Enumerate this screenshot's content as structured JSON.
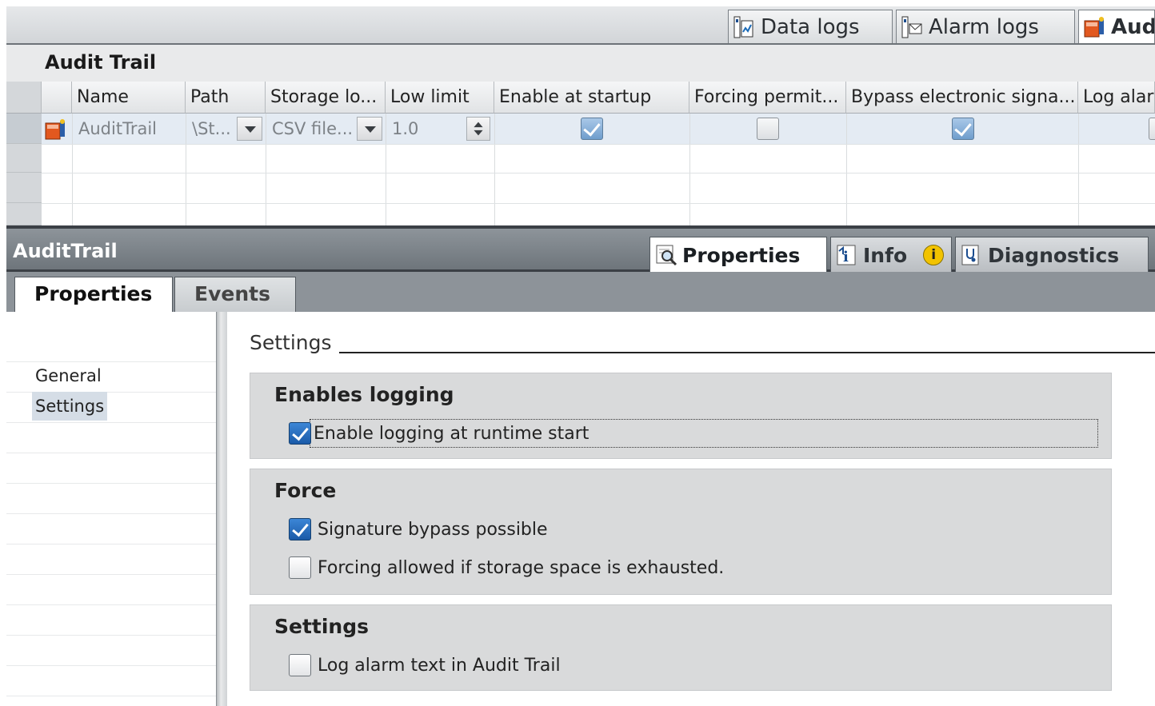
{
  "top_tabs": [
    {
      "label": "Data logs",
      "icon": "data-log-icon",
      "active": false
    },
    {
      "label": "Alarm logs",
      "icon": "alarm-log-icon",
      "active": false
    },
    {
      "label": "Aud",
      "icon": "audit-trail-icon",
      "active": true
    }
  ],
  "editor": {
    "title": "Audit Trail",
    "columns": [
      "Name",
      "Path",
      "Storage lo...",
      "Low limit",
      "Enable at startup",
      "Forcing permit...",
      "Bypass electronic signa...",
      "Log alar"
    ],
    "row": {
      "icon": "audit-trail-icon",
      "name": "AuditTrail",
      "path": "\\St...",
      "storage": "CSV file...",
      "low_limit": "1.0",
      "enable_at_startup": true,
      "forcing_permitted": false,
      "bypass_signature": true
    }
  },
  "inspector": {
    "title": "AuditTrail",
    "tabs": [
      {
        "label": "Properties",
        "icon": "magnifier-icon",
        "active": true
      },
      {
        "label": "Info",
        "icon": "info-icon",
        "badge": "i"
      },
      {
        "label": "Diagnostics",
        "icon": "diagnostics-icon"
      }
    ],
    "subtabs": [
      "Properties",
      "Events"
    ],
    "nav": [
      "General",
      "Settings"
    ],
    "nav_selected": "Settings",
    "section_heading": "Settings",
    "groups": [
      {
        "title": "Enables logging",
        "options": [
          {
            "label": "Enable logging at runtime start",
            "checked": true,
            "focused": true
          }
        ]
      },
      {
        "title": "Force",
        "options": [
          {
            "label": "Signature bypass possible",
            "checked": true
          },
          {
            "label": "Forcing allowed if storage space is exhausted.",
            "checked": false
          }
        ]
      },
      {
        "title": "Settings",
        "options": [
          {
            "label": "Log alarm text in Audit Trail",
            "checked": false
          }
        ]
      }
    ]
  },
  "colors": {
    "accent_blue": "#1a5aa8",
    "inspector_bar": "#6e757b",
    "group_bg": "#d9dadb",
    "selection": "#e4ebf3"
  }
}
